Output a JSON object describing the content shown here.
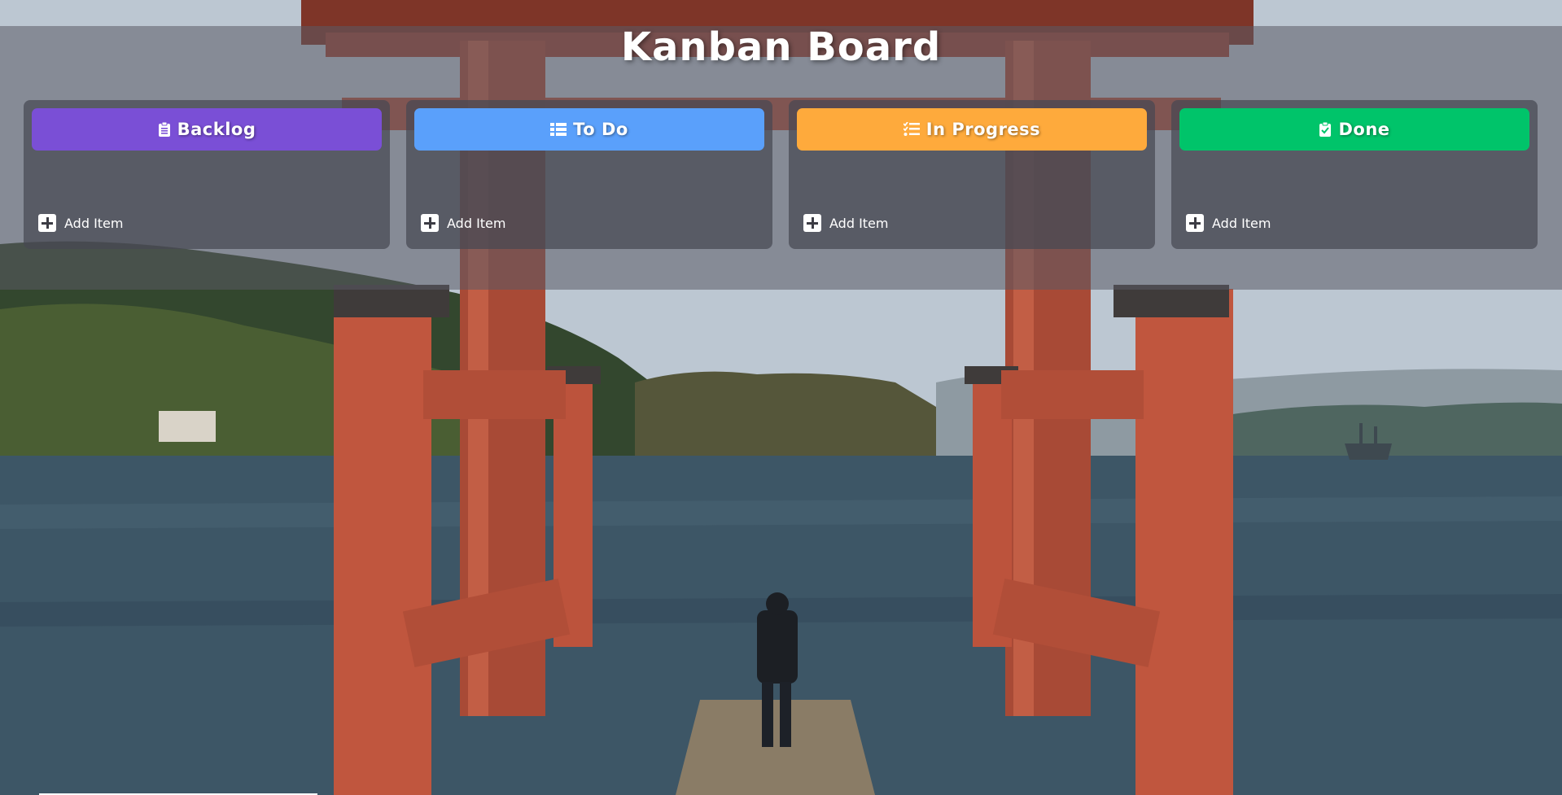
{
  "page": {
    "title": "Kanban Board"
  },
  "columns": [
    {
      "label": "Backlog",
      "color": "#7a4fd6",
      "icon": "clipboard-icon",
      "add_label": "Add Item"
    },
    {
      "label": "To Do",
      "color": "#5aa0fb",
      "icon": "list-icon",
      "add_label": "Add Item"
    },
    {
      "label": "In Progress",
      "color": "#feaa3c",
      "icon": "tasks-icon",
      "add_label": "Add Item"
    },
    {
      "label": "Done",
      "color": "#00c46a",
      "icon": "clipboard-check-icon",
      "add_label": "Add Item"
    }
  ],
  "colors": {
    "panel": "#5a5a64",
    "text": "#ffffff"
  }
}
